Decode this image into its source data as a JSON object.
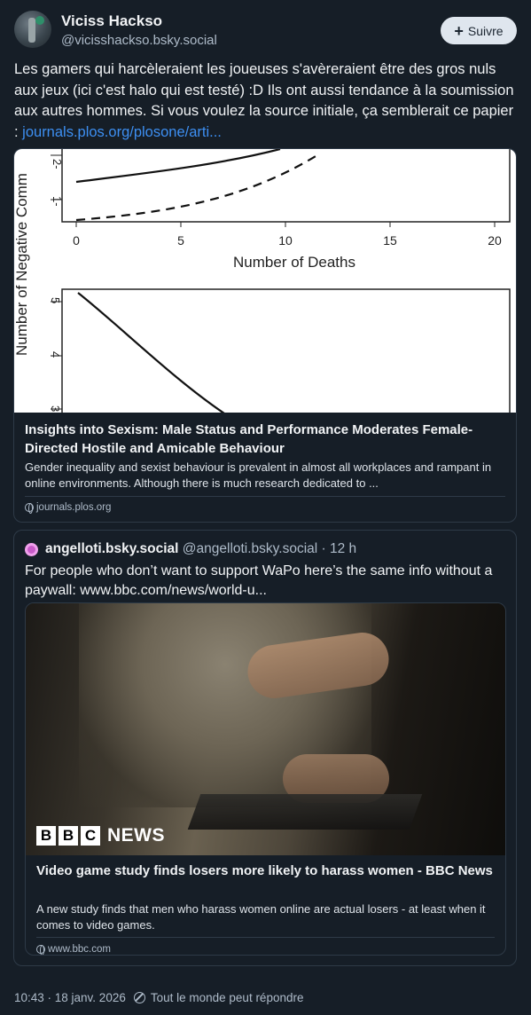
{
  "author": {
    "name": "Viciss Hackso",
    "handle": "@vicisshackso.bsky.social",
    "follow_label": "Suivre"
  },
  "post": {
    "text": "Les gamers qui harcèleraient les joueuses s'avèreraient être des gros nuls aux jeux (ici c'est halo qui est testé) :D Ils ont aussi tendance à la soumission aux autres hommes. Si vous voulez la source initiale, ça semblerait ce papier : ",
    "link_text": "journals.plos.org/plosone/arti..."
  },
  "link_card": {
    "figure": {
      "ylabel": "Number of Negative Comm",
      "xlabel": "Number of Deaths",
      "x_ticks": [
        "0",
        "5",
        "10",
        "15",
        "20"
      ],
      "top_y_ticks": [
        "2-",
        "1-"
      ],
      "bottom_y_ticks": [
        "5",
        "4",
        "3"
      ]
    },
    "title": "Insights into Sexism: Male Status and Performance Moderates Female-Directed Hostile and Amicable Behaviour",
    "description": "Gender inequality and sexist behaviour is prevalent in almost all workplaces and rampant in online environments. Although there is much research dedicated to ...",
    "domain": "journals.plos.org"
  },
  "quote": {
    "name": "angelloti.bsky.social",
    "handle": "@angelloti.bsky.social",
    "time": "· 12 h",
    "text": "For people who don’t want to support WaPo here’s the same info without a paywall: www.bbc.com/news/world-u...",
    "card": {
      "logo_letters": [
        "B",
        "B",
        "C"
      ],
      "logo_news": "NEWS",
      "title": "Video game study finds losers more likely to harass women - BBC News",
      "description": "A new study finds that men who harass women online are actual losers - at least when it comes to video games.",
      "domain": "www.bbc.com"
    }
  },
  "footer": {
    "timestamp": "10:43 · 18 janv. 2026",
    "reply_setting": "Tout le monde peut répondre"
  }
}
